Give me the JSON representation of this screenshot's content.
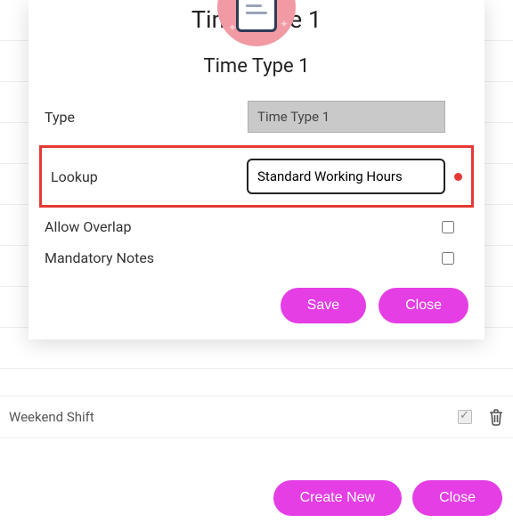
{
  "header_title": "Time Type 1",
  "modal": {
    "title_behind": "Ti          1",
    "subtitle": "Time Type 1",
    "type_label": "Type",
    "type_value": "Time Type 1",
    "lookup_label": "Lookup",
    "lookup_value": "Standard Working Hours",
    "allow_overlap_label": "Allow Overlap",
    "mandatory_notes_label": "Mandatory Notes",
    "save_label": "Save",
    "close_label": "Close"
  },
  "list": {
    "weekend_label": "Weekend Shift"
  },
  "footer": {
    "create_new": "Create New",
    "close": "Close"
  }
}
